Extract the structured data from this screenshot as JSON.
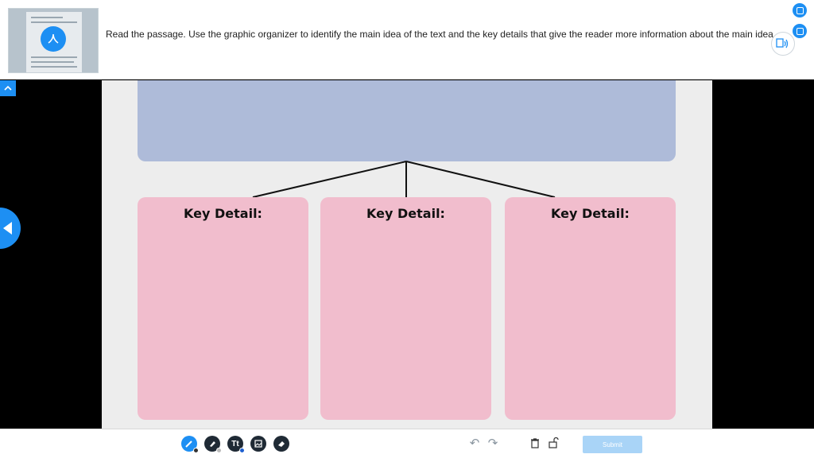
{
  "header": {
    "instructions": "Read the passage. Use the graphic organizer to identify the main idea of the text and the key details that give the reader more information about the main idea."
  },
  "organizer": {
    "main_box_color": "#aebbd9",
    "detail_box_color": "#f1bdcd",
    "details": [
      {
        "label": "Key Detail:"
      },
      {
        "label": "Key Detail:"
      },
      {
        "label": "Key Detail:"
      }
    ]
  },
  "toolbar": {
    "text_tool_label": "Tt",
    "submit_label": "Submit",
    "accent_color": "#1d8ff3"
  },
  "icons": {
    "pdf": "pdf-icon",
    "tts": "text-to-speech-icon",
    "pen": "pen-icon",
    "highlighter": "highlighter-icon",
    "image": "image-icon",
    "eraser": "eraser-icon",
    "undo": "undo-icon",
    "redo": "redo-icon",
    "trash": "trash-icon",
    "lock": "unlock-icon"
  }
}
